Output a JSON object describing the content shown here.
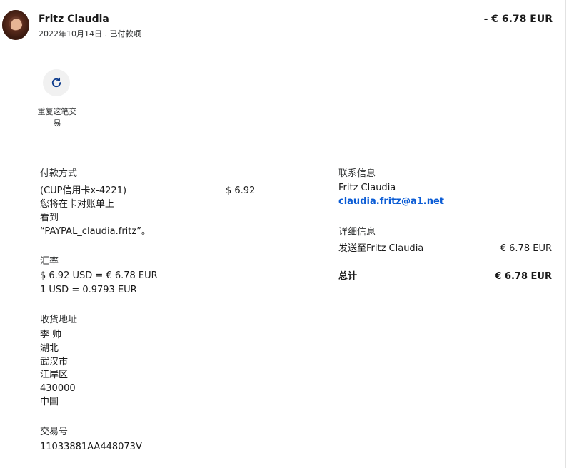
{
  "header": {
    "name": "Fritz Claudia",
    "subtitle": "2022年10月14日 . 已付款项",
    "amount": "- € 6.78 EUR"
  },
  "actions": {
    "repeat_label": "重复这笔交易",
    "repeat_icon": "refresh-icon"
  },
  "payment": {
    "heading": "付款方式",
    "card": "(CUP信用卡x-4221)",
    "card_amount": "$ 6.92",
    "note_line1": "您将在卡对账单上",
    "note_line2": "看到",
    "note_line3": "“PAYPAL_claudia.fritz”。"
  },
  "exchange": {
    "heading": "汇率",
    "line1": "$ 6.92 USD = € 6.78 EUR",
    "line2": "1 USD = 0.9793 EUR"
  },
  "shipping": {
    "heading": "收货地址",
    "lines": [
      "李 帅",
      "湖北",
      "武汉市",
      "江岸区",
      "430000",
      "中国"
    ]
  },
  "transaction": {
    "heading": "交易号",
    "id": "11033881AA448073V"
  },
  "contact": {
    "heading": "联系信息",
    "name": "Fritz Claudia",
    "email": "claudia.fritz@a1.net"
  },
  "details": {
    "heading": "详细信息",
    "sent_label": "发送至Fritz Claudia",
    "sent_amount": "€ 6.78 EUR",
    "total_label": "总计",
    "total_amount": "€ 6.78 EUR"
  },
  "colors": {
    "link": "#0b5cd5",
    "text": "#2c2e2f",
    "divider": "#ececec"
  }
}
